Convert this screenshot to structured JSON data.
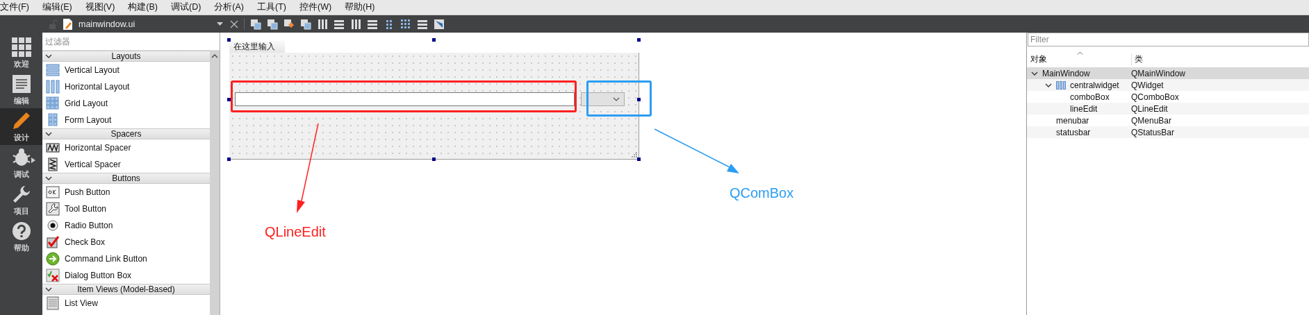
{
  "menu_bar": [
    "文件(F)",
    "编辑(E)",
    "视图(V)",
    "构建(B)",
    "调试(D)",
    "分析(A)",
    "工具(T)",
    "控件(W)",
    "帮助(H)"
  ],
  "mode_sidebar": [
    {
      "label": "欢迎",
      "kind": "welcome",
      "selected": false
    },
    {
      "label": "编辑",
      "kind": "edit",
      "selected": false
    },
    {
      "label": "设计",
      "kind": "design",
      "selected": true
    },
    {
      "label": "调试",
      "kind": "debug",
      "selected": false
    },
    {
      "label": "项目",
      "kind": "project",
      "selected": false
    },
    {
      "label": "帮助",
      "kind": "help",
      "selected": false
    }
  ],
  "editor_toolbar": {
    "file_name": "mainwindow.ui"
  },
  "widget_box": {
    "filter_placeholder": "过滤器",
    "categories": [
      {
        "title": "Layouts",
        "expanded": true,
        "items": [
          {
            "label": "Vertical Layout",
            "kind": "vlayout"
          },
          {
            "label": "Horizontal Layout",
            "kind": "hlayout"
          },
          {
            "label": "Grid Layout",
            "kind": "grid"
          },
          {
            "label": "Form Layout",
            "kind": "form"
          }
        ]
      },
      {
        "title": "Spacers",
        "expanded": true,
        "items": [
          {
            "label": "Horizontal Spacer",
            "kind": "hspacer"
          },
          {
            "label": "Vertical Spacer",
            "kind": "vspacer"
          }
        ]
      },
      {
        "title": "Buttons",
        "expanded": true,
        "items": [
          {
            "label": "Push Button",
            "kind": "push"
          },
          {
            "label": "Tool Button",
            "kind": "tool"
          },
          {
            "label": "Radio Button",
            "kind": "radio"
          },
          {
            "label": "Check Box",
            "kind": "check"
          },
          {
            "label": "Command Link Button",
            "kind": "commandlink"
          },
          {
            "label": "Dialog Button Box",
            "kind": "dialogbox"
          }
        ]
      },
      {
        "title": "Item Views (Model-Based)",
        "expanded": true,
        "items": [
          {
            "label": "List View",
            "kind": "list"
          }
        ]
      }
    ]
  },
  "form": {
    "menu_placeholder": "在这里输入"
  },
  "annotations": [
    {
      "label": "QLineEdit",
      "color": "#ff2020"
    },
    {
      "label": "QComBox",
      "color": "#2a9df4"
    }
  ],
  "object_inspector": {
    "filter_placeholder": "Filter",
    "columns": [
      "对象",
      "类"
    ],
    "tree": [
      {
        "object": "MainWindow",
        "class": "QMainWindow",
        "selected": true,
        "expanded": true,
        "children": [
          {
            "object": "centralwidget",
            "class": "QWidget",
            "kind": "layout",
            "selected": false,
            "expanded": true,
            "children": [
              {
                "object": "comboBox",
                "class": "QComboBox",
                "selected": false
              },
              {
                "object": "lineEdit",
                "class": "QLineEdit",
                "selected": false
              }
            ]
          },
          {
            "object": "menubar",
            "class": "QMenuBar",
            "selected": false
          },
          {
            "object": "statusbar",
            "class": "QStatusBar",
            "selected": false
          }
        ]
      }
    ]
  }
}
